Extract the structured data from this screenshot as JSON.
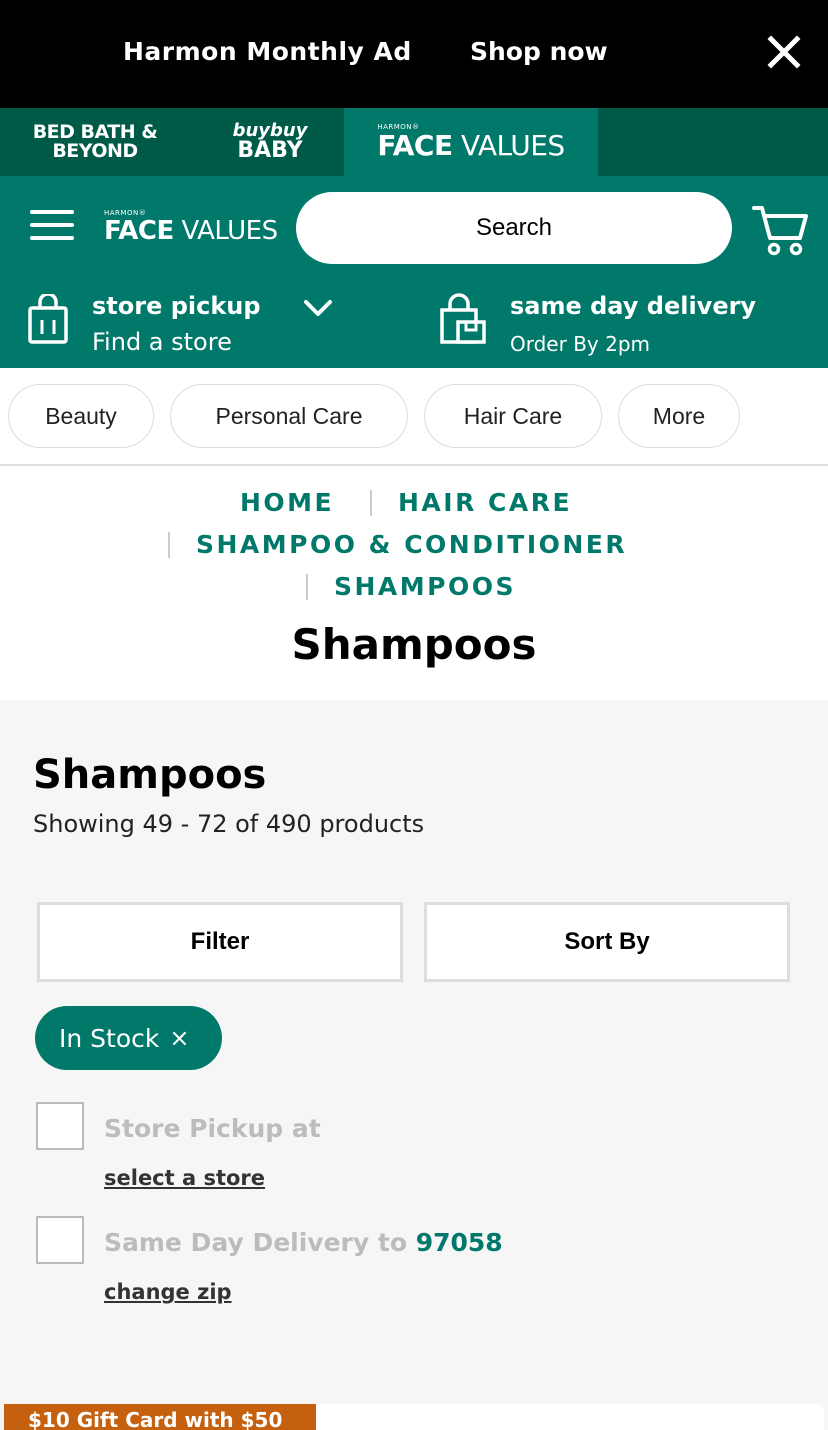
{
  "promo": {
    "title": "Harmon Monthly Ad",
    "cta": "Shop now"
  },
  "brands": {
    "bbb_line1": "BED BATH &",
    "bbb_line2": "BEYOND",
    "baby_line1": "buybuy",
    "baby_line2": "BABY",
    "fv_small": "HARMON®",
    "fv_bold": "FACE",
    "fv_light": " VALUES"
  },
  "header": {
    "logo_small": "HARMON®",
    "logo_bold": "FACE",
    "logo_light": " VALUES",
    "search_placeholder": "Search",
    "pickup_title": "store pickup",
    "pickup_sub": "Find a store",
    "delivery_title": "same day delivery",
    "delivery_sub": "Order By 2pm"
  },
  "categories": [
    "Beauty",
    "Personal Care",
    "Hair Care",
    "More"
  ],
  "breadcrumb": [
    "HOME",
    "HAIR CARE",
    "SHAMPOO & CONDITIONER",
    "SHAMPOOS"
  ],
  "page_title": "Shampoos",
  "results": {
    "title": "Shampoos",
    "count": "Showing 49 - 72 of 490 products",
    "filter_label": "Filter",
    "sort_label": "Sort By",
    "chip_label": "In Stock",
    "chip_remove": "×",
    "pickup_label": "Store Pickup at",
    "pickup_link": "select a store",
    "delivery_label": "Same Day Delivery to ",
    "delivery_zip": "97058",
    "delivery_link": "change zip"
  },
  "product_badge": "$10 Gift Card with $50",
  "colors": {
    "brand_green": "#00796b",
    "dark_green": "#005a48",
    "badge_orange": "#c4600e"
  }
}
